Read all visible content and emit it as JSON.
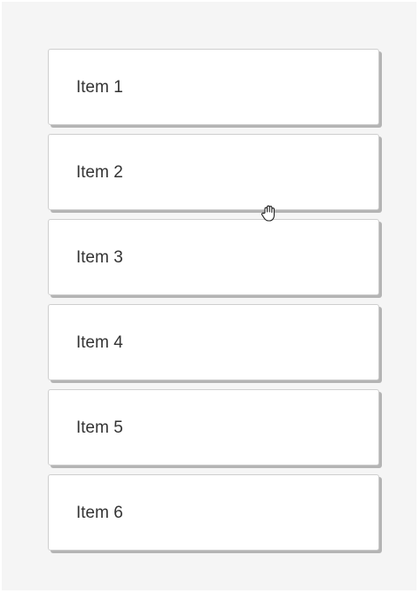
{
  "list": {
    "items": [
      {
        "label": "Item 1"
      },
      {
        "label": "Item 2"
      },
      {
        "label": "Item 3"
      },
      {
        "label": "Item 4"
      },
      {
        "label": "Item 5"
      },
      {
        "label": "Item 6"
      }
    ]
  },
  "cursor": {
    "icon": "grab-hand-icon"
  },
  "colors": {
    "background": "#f5f5f5",
    "card": "#ffffff",
    "card_border": "#cfcfcf",
    "card_shadow": "#b4b4b4",
    "text": "#333333"
  }
}
